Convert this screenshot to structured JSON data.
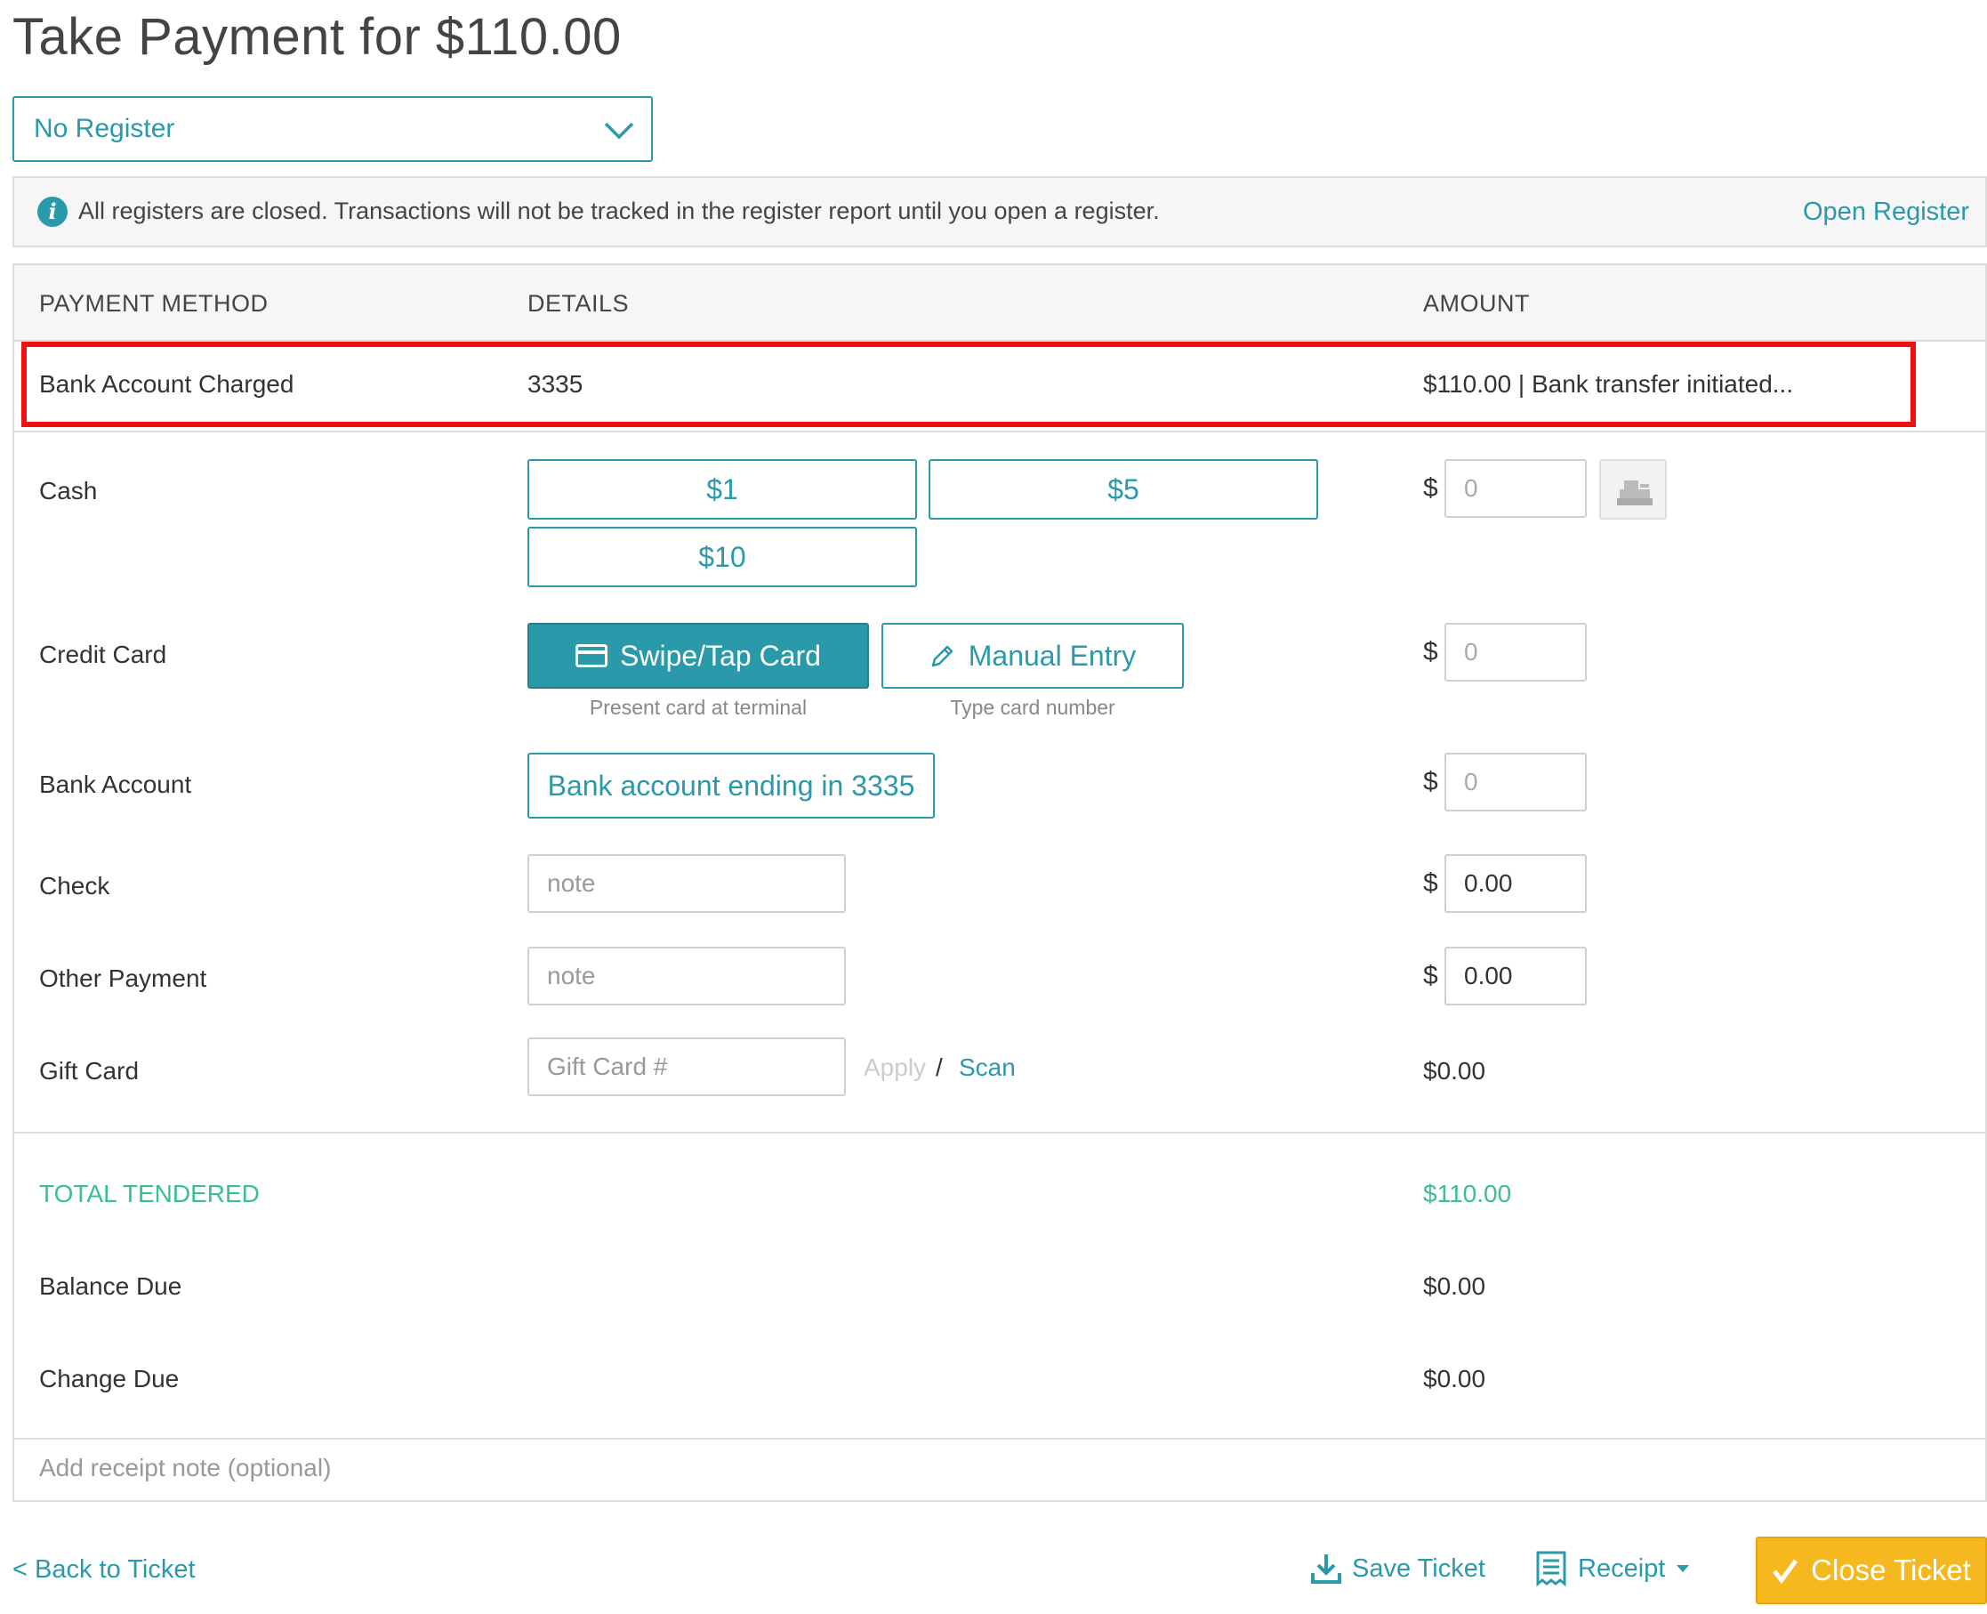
{
  "page": {
    "title": "Take Payment for $110.00"
  },
  "register": {
    "selected": "No Register"
  },
  "alert": {
    "icon": "info-icon",
    "message": "All registers are closed. Transactions will not be tracked in the register report until you open a register.",
    "link": "Open Register"
  },
  "table": {
    "headers": {
      "method": "PAYMENT METHOD",
      "details": "DETAILS",
      "amount": "AMOUNT"
    },
    "charged": {
      "method": "Bank Account Charged",
      "details": "3335",
      "amount": "$110.00 | Bank transfer initiated..."
    },
    "cash": {
      "label": "Cash",
      "btn1": "$1",
      "btn5": "$5",
      "btn10": "$10",
      "currency": "$",
      "placeholder": "0"
    },
    "credit": {
      "label": "Credit Card",
      "swipe": "Swipe/Tap Card",
      "swipe_hint": "Present card at terminal",
      "manual": "Manual Entry",
      "manual_hint": "Type card number",
      "currency": "$",
      "placeholder": "0"
    },
    "bank": {
      "label": "Bank Account",
      "button": "Bank account ending in 3335",
      "currency": "$",
      "placeholder": "0"
    },
    "check": {
      "label": "Check",
      "note_placeholder": "note",
      "currency": "$",
      "value": "0.00"
    },
    "other": {
      "label": "Other Payment",
      "note_placeholder": "note",
      "currency": "$",
      "value": "0.00"
    },
    "gift": {
      "label": "Gift Card",
      "placeholder": "Gift Card #",
      "apply": "Apply",
      "slash": "/",
      "scan": "Scan",
      "amount": "$0.00"
    },
    "totals": {
      "tendered_label": "TOTAL TENDERED",
      "tendered": "$110.00",
      "balance_label": "Balance Due",
      "balance": "$0.00",
      "change_label": "Change Due",
      "change": "$0.00"
    },
    "receipt_note_placeholder": "Add receipt note (optional)"
  },
  "footer": {
    "back": "< Back to Ticket",
    "save": "Save Ticket",
    "receipt": "Receipt",
    "close": "Close Ticket"
  },
  "colors": {
    "accent": "#2a9aaa",
    "green": "#3cbf8e",
    "highlight": "#ee1111",
    "close": "#f5b81f"
  }
}
